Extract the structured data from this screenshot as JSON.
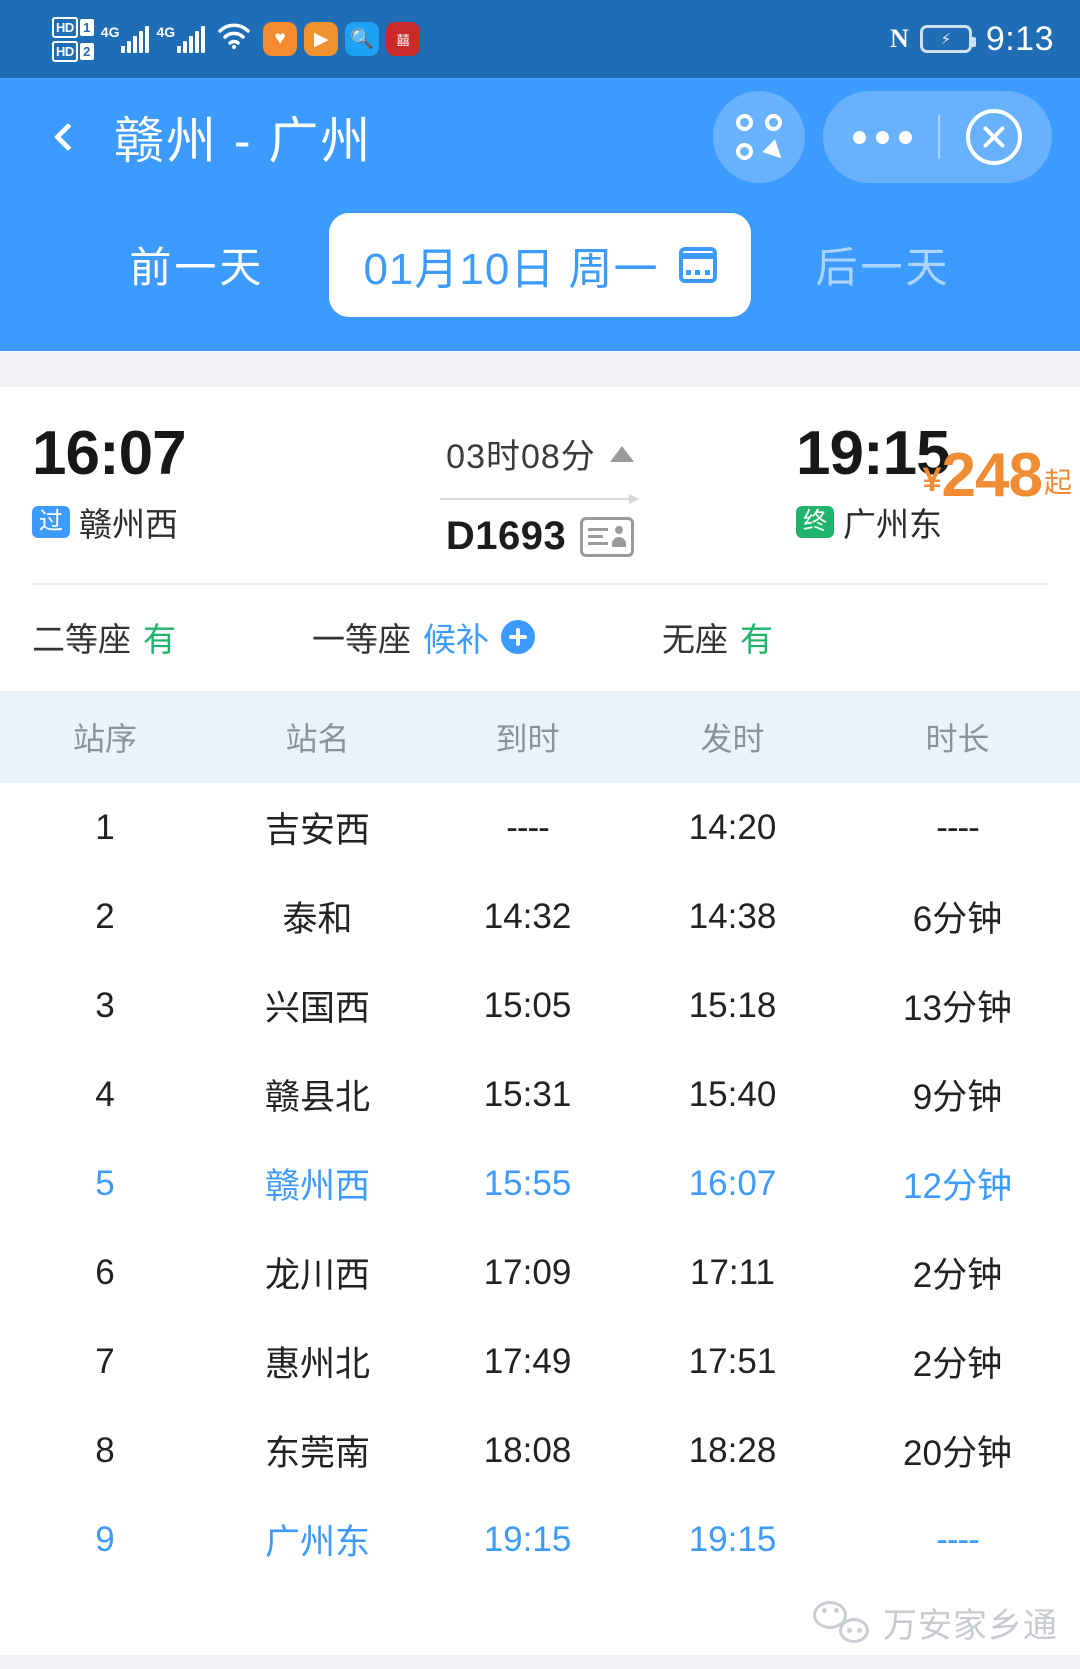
{
  "status_bar": {
    "hd1_label": "HD",
    "hd1_num": "1",
    "hd2_label": "HD",
    "hd2_num": "2",
    "network1": "4G",
    "network2": "4G",
    "icons": [
      "wifi-icon",
      "health-app-icon",
      "media-app-icon",
      "search-app-icon",
      "gov-app-icon",
      "nfc-icon",
      "battery-charging-icon"
    ],
    "nfc_label": "N",
    "time": "9:13"
  },
  "header": {
    "back_icon": "chevron-left-icon",
    "route_title": "赣州 - 广州",
    "mini_program_icon": "mini-program-menu-icon",
    "more_icon": "more-options-icon",
    "close_icon": "close-circle-icon",
    "prev_day": "前一天",
    "next_day": "后一天",
    "date_text": "01月10日 周一",
    "calendar_icon": "calendar-icon",
    "accent_color": "#3d9bfd"
  },
  "train": {
    "depart_time": "16:07",
    "depart_badge": "过",
    "depart_station": "赣州西",
    "duration": "03时08分",
    "duration_arrow_icon": "triangle-up-icon",
    "train_no": "D1693",
    "id_icon": "id-card-icon",
    "arrive_time": "19:15",
    "arrive_badge": "终",
    "arrive_station": "广州东",
    "currency": "¥",
    "price": "248",
    "price_suffix": "起",
    "price_color": "#f08c33",
    "seats": [
      {
        "label": "二等座",
        "value": "有",
        "state": "available"
      },
      {
        "label": "一等座",
        "value": "候补",
        "state": "waitlist",
        "plus_icon": "plus-circle-icon"
      },
      {
        "label": "无座",
        "value": "有",
        "state": "available"
      }
    ]
  },
  "schedule": {
    "columns": [
      "站序",
      "站名",
      "到时",
      "发时",
      "时长"
    ],
    "rows": [
      {
        "no": "1",
        "station": "吉安西",
        "arrive": "----",
        "depart": "14:20",
        "stop": "----",
        "highlight": false
      },
      {
        "no": "2",
        "station": "泰和",
        "arrive": "14:32",
        "depart": "14:38",
        "stop": "6分钟",
        "highlight": false
      },
      {
        "no": "3",
        "station": "兴国西",
        "arrive": "15:05",
        "depart": "15:18",
        "stop": "13分钟",
        "highlight": false
      },
      {
        "no": "4",
        "station": "赣县北",
        "arrive": "15:31",
        "depart": "15:40",
        "stop": "9分钟",
        "highlight": false
      },
      {
        "no": "5",
        "station": "赣州西",
        "arrive": "15:55",
        "depart": "16:07",
        "stop": "12分钟",
        "highlight": true
      },
      {
        "no": "6",
        "station": "龙川西",
        "arrive": "17:09",
        "depart": "17:11",
        "stop": "2分钟",
        "highlight": false
      },
      {
        "no": "7",
        "station": "惠州北",
        "arrive": "17:49",
        "depart": "17:51",
        "stop": "2分钟",
        "highlight": false
      },
      {
        "no": "8",
        "station": "东莞南",
        "arrive": "18:08",
        "depart": "18:28",
        "stop": "20分钟",
        "highlight": false
      },
      {
        "no": "9",
        "station": "广州东",
        "arrive": "19:15",
        "depart": "19:15",
        "stop": "----",
        "highlight": true
      }
    ]
  },
  "watermark": {
    "icon": "wechat-icon",
    "text": "万安家乡通"
  }
}
